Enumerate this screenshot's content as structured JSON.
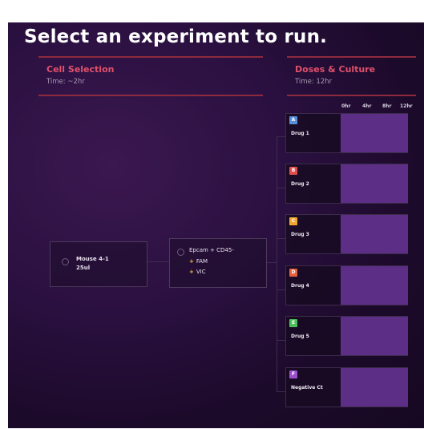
{
  "page": {
    "title": "Select an experiment to run."
  },
  "cell_selection": {
    "title": "Cell Selection",
    "time": "Time: ~2hr"
  },
  "doses_culture": {
    "title": "Doses & Culture",
    "time": "Time: 12hr",
    "timeline_ticks": [
      "0hr",
      "4hr",
      "8hr",
      "12hr"
    ]
  },
  "source": {
    "name": "Mouse 4-1",
    "volume": "25ul"
  },
  "sort": {
    "label": "Epcam + CD45-",
    "markers": [
      {
        "icon": "plus-icon",
        "label": "FAM"
      },
      {
        "icon": "plus-icon",
        "label": "VIC"
      }
    ]
  },
  "drugs": [
    {
      "badge": "A",
      "label": "Drug 1",
      "color": "#5a8fd8",
      "bar_fraction": 1.0
    },
    {
      "badge": "B",
      "label": "Drug 2",
      "color": "#e04b4b",
      "bar_fraction": 1.0
    },
    {
      "badge": "C",
      "label": "Drug 3",
      "color": "#f2a72e",
      "bar_fraction": 1.0
    },
    {
      "badge": "D",
      "label": "Drug 4",
      "color": "#e5603d",
      "bar_fraction": 1.0
    },
    {
      "badge": "E",
      "label": "Drug 5",
      "color": "#4bbf5a",
      "bar_fraction": 1.0
    },
    {
      "badge": "F",
      "label": "Negative Ct",
      "color": "#9b4fd0",
      "bar_fraction": 1.0
    }
  ],
  "colors": {
    "panel_bg": "#1c0a2a",
    "accent_red": "#e0506a",
    "bar_purple": "#5c2e86",
    "marker_yellow": "#f2c23a"
  }
}
